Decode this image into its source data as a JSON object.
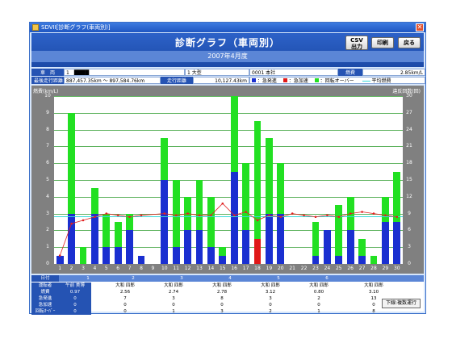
{
  "window": {
    "title": "SDVII[診断グラフ(車両別)]",
    "close_glyph": "✕"
  },
  "header": {
    "title": "診断グラフ（車両別）",
    "subtitle": "2007年4月度"
  },
  "toolbar": {
    "csv_label": "CSV\n出力",
    "print_label": "印刷",
    "back_label": "戻る"
  },
  "info": {
    "vehicle_label": "車　両",
    "vehicle_value": "1　████",
    "type_value": "1  大型",
    "office_value": "0001  本社",
    "fuel_label": "燃費",
    "fuel_value": "2.85km/L",
    "odometer_label": "最後走行距離",
    "odometer_value": "887,457.35km ～ 897,584.76km",
    "distance_label": "走行距離",
    "distance_value": "10,127.43km",
    "legend_overspeed": "：急発進",
    "legend_brake": "：急加速",
    "legend_revs": "：回転オーバー",
    "legend_avg": "平均燃費"
  },
  "chart_data": {
    "type": "bar",
    "left_axis_label": "燃費(km/L)",
    "right_axis_label": "違反回数(回)",
    "ylim_left": [
      0,
      10
    ],
    "ylim_right": [
      0,
      30
    ],
    "categories": [
      "1",
      "2",
      "3",
      "4",
      "5",
      "6",
      "7",
      "8",
      "9",
      "10",
      "11",
      "12",
      "13",
      "14",
      "15",
      "16",
      "17",
      "18",
      "19",
      "20",
      "21",
      "22",
      "23",
      "24",
      "25",
      "26",
      "27",
      "28",
      "29",
      "30"
    ],
    "series": [
      {
        "name": "急発進",
        "color": "#1a2fd0",
        "values": [
          0.5,
          3,
          0,
          3,
          1,
          1,
          2,
          0.5,
          0,
          5,
          1,
          2,
          2,
          1,
          0.5,
          5.5,
          2,
          0,
          3,
          3,
          0,
          0,
          0.5,
          2,
          0.5,
          2,
          0.5,
          0,
          2.5,
          2.5
        ]
      },
      {
        "name": "急加速",
        "color": "#e01818",
        "values": [
          0,
          0,
          0,
          0,
          0,
          0,
          0,
          0,
          0,
          0,
          0,
          0,
          0,
          0,
          0,
          0,
          0,
          1.5,
          0,
          0,
          0,
          0,
          0,
          0,
          0,
          0,
          0,
          0,
          0,
          0
        ]
      },
      {
        "name": "回転オーバー",
        "color": "#22e022",
        "values": [
          0,
          6,
          1,
          1.5,
          2,
          1.5,
          1,
          0,
          0,
          2.5,
          4,
          2,
          3,
          3,
          0.5,
          10,
          4,
          7,
          4.5,
          3,
          0,
          0,
          2,
          0,
          3,
          2,
          1,
          0.5,
          1.5,
          3
        ]
      }
    ],
    "fuel_line": {
      "name": "燃費",
      "values": [
        0.5,
        2.4,
        2.6,
        2.8,
        3.0,
        2.9,
        2.8,
        2.9,
        0,
        3.0,
        2.9,
        3.0,
        2.9,
        2.9,
        3.6,
        2.9,
        3.1,
        2.6,
        2.9,
        2.8,
        3.0,
        2.9,
        2.8,
        2.9,
        2.8,
        3.0,
        3.1,
        3.0,
        2.9,
        2.8
      ]
    },
    "average_fuel": 2.85
  },
  "table": {
    "header_row": [
      "日付",
      "1",
      "2",
      "3",
      "4",
      "5",
      "6"
    ],
    "rows": [
      {
        "label": "運転者",
        "cells": [
          "午前 美博",
          "大和 四郎",
          "大和 四郎",
          "大和 四郎",
          "大和 四郎",
          "大和 四郎",
          "大和 四郎"
        ]
      },
      {
        "label": "燃費",
        "cells": [
          "0.97",
          "2.56",
          "2.74",
          "2.78",
          "3.12",
          "0.80",
          "3.10"
        ]
      },
      {
        "label": "急発進",
        "cells": [
          "0",
          "7",
          "3",
          "8",
          "3",
          "2",
          "13"
        ]
      },
      {
        "label": "急加速",
        "cells": [
          "0",
          "0",
          "0",
          "0",
          "0",
          "0",
          "0"
        ]
      },
      {
        "label": "回転ｵｰﾊﾞｰ",
        "cells": [
          "0",
          "0",
          "1",
          "3",
          "2",
          "1",
          "8"
        ]
      }
    ]
  },
  "status": {
    "text": "下線:複数運行"
  }
}
